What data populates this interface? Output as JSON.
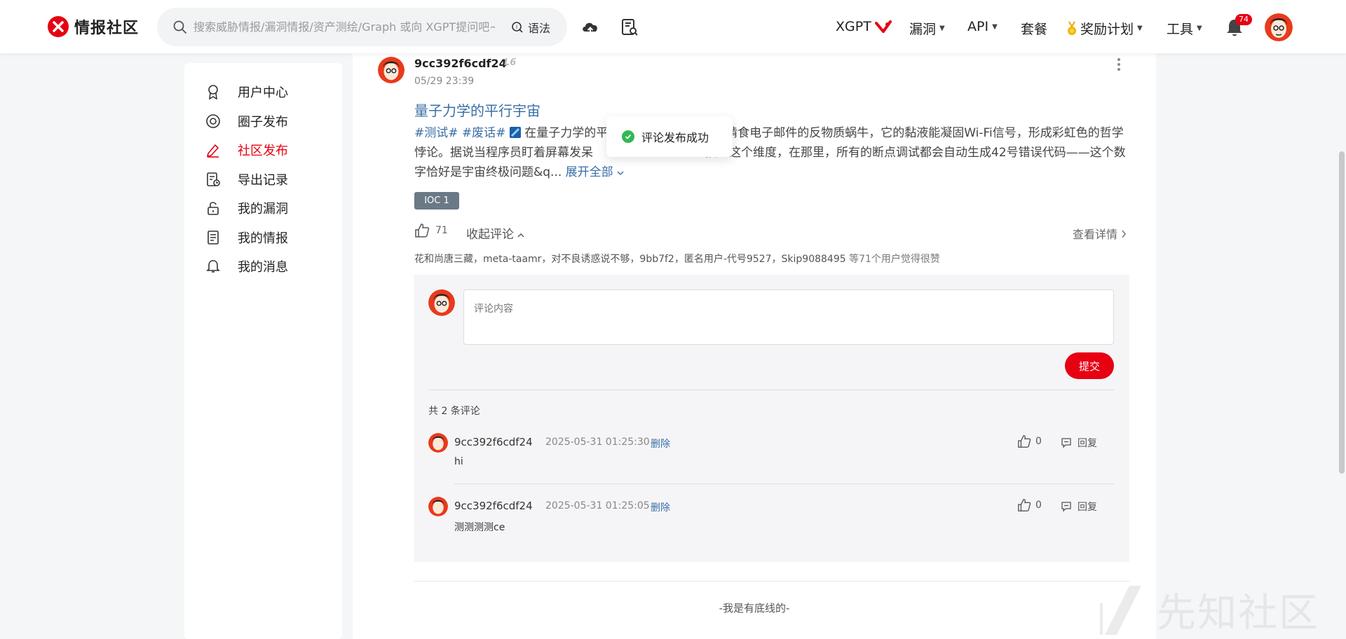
{
  "header": {
    "logo_text": "情报社区",
    "search_placeholder": "搜索威胁情报/漏洞情报/资产测绘/Graph 或向 XGPT提问吧~",
    "syntax_label": "语法",
    "nav": [
      "XGPT",
      "漏洞",
      "API",
      "套餐",
      "奖励计划",
      "工具"
    ],
    "notification_count": "74"
  },
  "sidebar": {
    "items": [
      {
        "label": "用户中心",
        "icon": "badge-icon"
      },
      {
        "label": "圈子发布",
        "icon": "target-icon"
      },
      {
        "label": "社区发布",
        "icon": "edit-icon"
      },
      {
        "label": "导出记录",
        "icon": "export-record-icon"
      },
      {
        "label": "我的漏洞",
        "icon": "unlock-icon"
      },
      {
        "label": "我的情报",
        "icon": "document-icon"
      },
      {
        "label": "我的消息",
        "icon": "bell-icon"
      }
    ],
    "active_index": 2
  },
  "post": {
    "author": "9cc392f6cdf24",
    "level": "L6",
    "time": "05/29 23:39",
    "title": "量子力学的平行宇宙",
    "tags": [
      "#测试#",
      "#废话#"
    ],
    "body_part1": "在量子力学的平",
    "body_part2": "啃食电子邮件的反物质蜗牛，它的黏液能凝固Wi-Fi信号，形成彩虹色的哲学悖论。据说当程序员盯着屏幕发呆",
    "body_part3": "接入这个维度，在那里，所有的断点调试都会自动生成42号错误代码——这个数字恰好是宇宙终极问题&q...",
    "expand_label": "展开全部",
    "ioc_label": "IOC 1",
    "like_count": "71",
    "collapse_label": "收起评论",
    "details_label": "查看详情",
    "likers": "花和尚唐三藏，meta-taamr，对不良诱惑说不够，9bb7f2，匿名用户-代号9527，Skip9088495",
    "likers_tail": "等71个用户觉得很赞"
  },
  "comment_box": {
    "placeholder": "评论内容",
    "submit_label": "提交",
    "count_label": "共 2 条评论",
    "comments": [
      {
        "author": "9cc392f6cdf24",
        "time": "2025-05-31 01:25:30",
        "delete": "删除",
        "text": "hi",
        "likes": "0",
        "reply": "回复"
      },
      {
        "author": "9cc392f6cdf24",
        "time": "2025-05-31 01:25:05",
        "delete": "删除",
        "text": "测测测测ce",
        "likes": "0",
        "reply": "回复"
      }
    ]
  },
  "footer": {
    "end_text": "-我是有底线的-"
  },
  "toast": {
    "message": "评论发布成功"
  },
  "watermark": {
    "text": "先知社区"
  },
  "colors": {
    "brand": "#e60012",
    "link": "#3a6ea5",
    "success": "#31b855"
  }
}
